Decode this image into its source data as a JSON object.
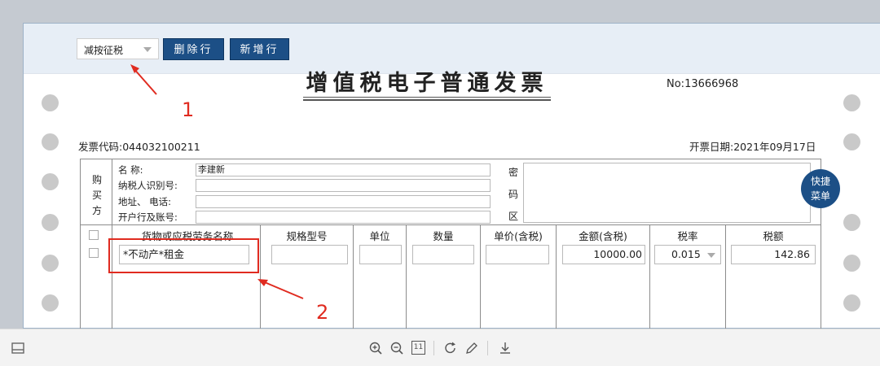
{
  "toolbar": {
    "tax_mode_select": "减按征税",
    "delete_row_label": "删除行",
    "add_row_label": "新增行"
  },
  "invoice": {
    "title": "增值税电子普通发票",
    "number_label": "No:",
    "number": "13666968",
    "code_label": "发票代码:",
    "code": "044032100211",
    "date_label": "开票日期:",
    "date": "2021年09月17日"
  },
  "buyer": {
    "side_label": [
      "购",
      "买",
      "方"
    ],
    "fields": [
      {
        "label": "名        称:",
        "value": "李建新"
      },
      {
        "label": "纳税人识别号:",
        "value": ""
      },
      {
        "label": "地址、 电话:",
        "value": ""
      },
      {
        "label": "开户行及账号:",
        "value": ""
      }
    ],
    "cipher_label": [
      "密",
      "码",
      "区"
    ]
  },
  "quick_menu": {
    "line1": "快捷",
    "line2": "菜单"
  },
  "items_table": {
    "headers": [
      "货物或应税劳务名称",
      "规格型号",
      "单位",
      "数量",
      "单价(含税)",
      "金额(含税)",
      "税率",
      "税额"
    ],
    "row": {
      "name": "*不动产*租金",
      "spec": "",
      "unit": "",
      "quantity": "",
      "unit_price": "",
      "amount": "10000.00",
      "tax_rate": "0.015",
      "tax": "142.86"
    }
  },
  "annotations": {
    "label1": "1",
    "label2": "2"
  },
  "colors": {
    "accent": "#1c4f86",
    "annotation": "#e02b20"
  },
  "bottom_toolbar": {
    "icons": [
      "sidebar-toggle-icon",
      "zoom-in-icon",
      "zoom-out-icon",
      "page-fit-icon",
      "rotate-icon",
      "edit-pen-icon",
      "download-icon"
    ],
    "page_box": "11"
  }
}
